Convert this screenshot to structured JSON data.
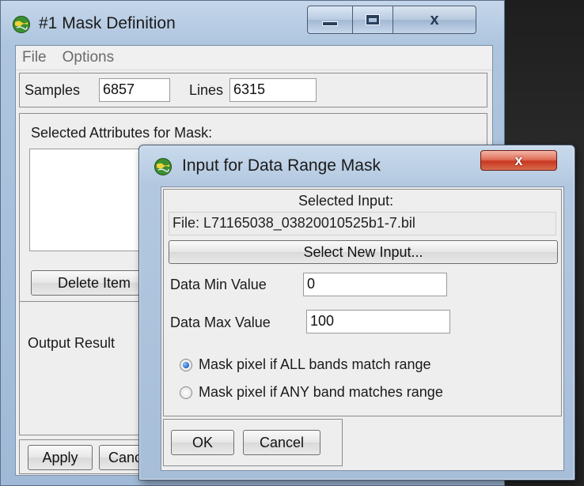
{
  "main_window": {
    "title": "#1 Mask Definition",
    "caption_close": "x",
    "menu": [
      "File",
      "Options"
    ],
    "samples_label": "Samples",
    "samples_value": "6857",
    "lines_label": "Lines",
    "lines_value": "6315",
    "attributes_label": "Selected Attributes for Mask:",
    "delete_button": "Delete Item",
    "output_label": "Output Result",
    "apply_button": "Apply",
    "cancel_button_partial": "Cancel"
  },
  "dialog": {
    "title": "Input for Data Range Mask",
    "close_label": "x",
    "selected_input_label": "Selected Input:",
    "file_text": "File: L71165038_03820010525b1-7.bil",
    "select_new_input_button": "Select New Input...",
    "data_min_label": "Data Min Value",
    "data_min_value": "0",
    "data_max_label": "Data Max Value",
    "data_max_value": "100",
    "radio_options": [
      {
        "label": "Mask pixel if ALL bands match range",
        "checked": true
      },
      {
        "label": "Mask pixel if ANY band matches range",
        "checked": false
      }
    ],
    "ok_button": "OK",
    "cancel_button": "Cancel"
  },
  "icons": {
    "app_icon": "globe-icon",
    "minimize": "minimize-icon",
    "maximize": "maximize-icon",
    "close": "close-icon"
  },
  "colors": {
    "title_bar": "#aec5df",
    "dialog_close": "#c8381f",
    "radio_selected": "#1f62c8"
  }
}
